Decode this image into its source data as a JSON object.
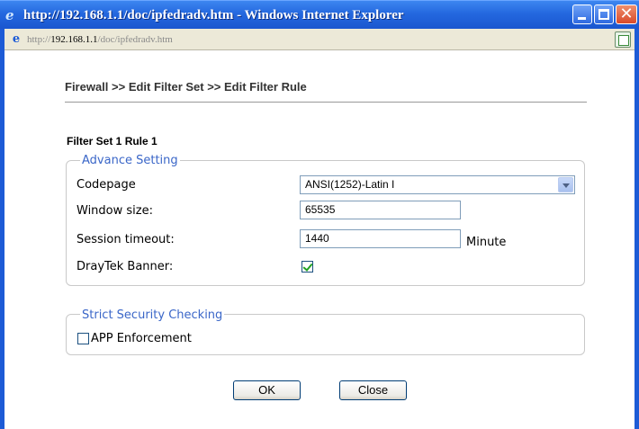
{
  "window": {
    "title": "http://192.168.1.1/doc/ipfedradv.htm - Windows Internet Explorer",
    "url_prefix": "http://",
    "url_host": "192.168.1.1",
    "url_path": "/doc/ipfedradv.htm"
  },
  "page": {
    "title": "Firewall >> Edit Filter Set >> Edit Filter Rule",
    "section_title": "Filter Set 1 Rule 1"
  },
  "advance": {
    "legend": "Advance Setting",
    "codepage_label": "Codepage",
    "codepage_value": "ANSI(1252)-Latin I",
    "window_size_label": "Window size:",
    "window_size_value": "65535",
    "session_timeout_label": "Session timeout:",
    "session_timeout_value": "1440",
    "session_timeout_unit": "Minute",
    "banner_label": "DrayTek Banner:",
    "banner_checked": true
  },
  "strict": {
    "legend": "Strict Security Checking",
    "app_label": "APP Enforcement",
    "app_checked": false
  },
  "buttons": {
    "ok": "OK",
    "close": "Close"
  },
  "icons": {
    "ie": "internet-explorer-icon",
    "page": "page-icon"
  }
}
